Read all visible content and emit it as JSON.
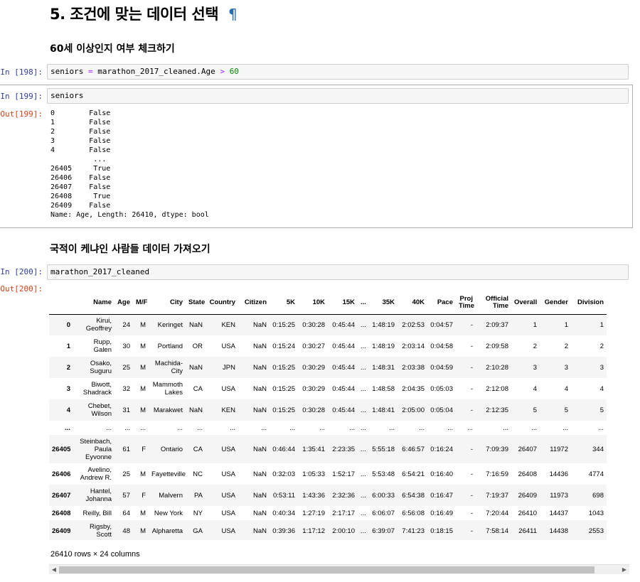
{
  "heading": {
    "title": "5. 조건에 맞는 데이터 선택",
    "anchor": "¶"
  },
  "sub1": "60세 이상인지 여부 체크하기",
  "cell198": {
    "prompt": "In [198]:",
    "code_var": "seniors",
    "code_eq": "=",
    "code_expr": "marathon_2017_cleaned.Age",
    "code_op": ">",
    "code_num": "60"
  },
  "cell199": {
    "prompt": "In [199]:",
    "code": "seniors",
    "out_prompt": "Out[199]:",
    "output": "0        False\n1        False\n2        False\n3        False\n4        False\n          ...\n26405     True\n26406    False\n26407    False\n26408     True\n26409    False\nName: Age, Length: 26410, dtype: bool"
  },
  "sub2": "국적이 케냐인 사람들 데이터 가져오기",
  "cell200": {
    "prompt": "In [200]:",
    "code": "marathon_2017_cleaned",
    "out_prompt": "Out[200]:"
  },
  "table": {
    "columns": [
      "",
      "Name",
      "Age",
      "M/F",
      "City",
      "State",
      "Country",
      "Citizen",
      "5K",
      "10K",
      "15K",
      "...",
      "35K",
      "40K",
      "Pace",
      "Proj Time",
      "Official Time",
      "Overall",
      "Gender",
      "Division"
    ],
    "rows": [
      [
        "0",
        "Kirui, Geoffrey",
        "24",
        "M",
        "Keringet",
        "NaN",
        "KEN",
        "NaN",
        "0:15:25",
        "0:30:28",
        "0:45:44",
        "...",
        "1:48:19",
        "2:02:53",
        "0:04:57",
        "-",
        "2:09:37",
        "1",
        "1",
        "1"
      ],
      [
        "1",
        "Rupp, Galen",
        "30",
        "M",
        "Portland",
        "OR",
        "USA",
        "NaN",
        "0:15:24",
        "0:30:27",
        "0:45:44",
        "...",
        "1:48:19",
        "2:03:14",
        "0:04:58",
        "-",
        "2:09:58",
        "2",
        "2",
        "2"
      ],
      [
        "2",
        "Osako, Suguru",
        "25",
        "M",
        "Machida-City",
        "NaN",
        "JPN",
        "NaN",
        "0:15:25",
        "0:30:29",
        "0:45:44",
        "...",
        "1:48:31",
        "2:03:38",
        "0:04:59",
        "-",
        "2:10:28",
        "3",
        "3",
        "3"
      ],
      [
        "3",
        "Biwott, Shadrack",
        "32",
        "M",
        "Mammoth Lakes",
        "CA",
        "USA",
        "NaN",
        "0:15:25",
        "0:30:29",
        "0:45:44",
        "...",
        "1:48:58",
        "2:04:35",
        "0:05:03",
        "-",
        "2:12:08",
        "4",
        "4",
        "4"
      ],
      [
        "4",
        "Chebet, Wilson",
        "31",
        "M",
        "Marakwet",
        "NaN",
        "KEN",
        "NaN",
        "0:15:25",
        "0:30:28",
        "0:45:44",
        "...",
        "1:48:41",
        "2:05:00",
        "0:05:04",
        "-",
        "2:12:35",
        "5",
        "5",
        "5"
      ],
      [
        "...",
        "...",
        "...",
        "...",
        "...",
        "...",
        "...",
        "...",
        "...",
        "...",
        "...",
        "...",
        "...",
        "...",
        "...",
        "...",
        "...",
        "...",
        "...",
        "..."
      ],
      [
        "26405",
        "Steinbach, Paula Eyvonne",
        "61",
        "F",
        "Ontario",
        "CA",
        "USA",
        "NaN",
        "0:46:44",
        "1:35:41",
        "2:23:35",
        "...",
        "5:55:18",
        "6:46:57",
        "0:16:24",
        "-",
        "7:09:39",
        "26407",
        "11972",
        "344"
      ],
      [
        "26406",
        "Avelino, Andrew R.",
        "25",
        "M",
        "Fayetteville",
        "NC",
        "USA",
        "NaN",
        "0:32:03",
        "1:05:33",
        "1:52:17",
        "...",
        "5:53:48",
        "6:54:21",
        "0:16:40",
        "-",
        "7:16:59",
        "26408",
        "14436",
        "4774"
      ],
      [
        "26407",
        "Hantel, Johanna",
        "57",
        "F",
        "Malvern",
        "PA",
        "USA",
        "NaN",
        "0:53:11",
        "1:43:36",
        "2:32:36",
        "...",
        "6:00:33",
        "6:54:38",
        "0:16:47",
        "-",
        "7:19:37",
        "26409",
        "11973",
        "698"
      ],
      [
        "26408",
        "Reilly, Bill",
        "64",
        "M",
        "New York",
        "NY",
        "USA",
        "NaN",
        "0:40:34",
        "1:27:19",
        "2:17:17",
        "...",
        "6:06:07",
        "6:56:08",
        "0:16:49",
        "-",
        "7:20:44",
        "26410",
        "14437",
        "1043"
      ],
      [
        "26409",
        "Rigsby, Scott",
        "48",
        "M",
        "Alpharetta",
        "GA",
        "USA",
        "NaN",
        "0:39:36",
        "1:17:12",
        "2:00:10",
        "...",
        "6:39:07",
        "7:41:23",
        "0:18:15",
        "-",
        "7:58:14",
        "26411",
        "14438",
        "2553"
      ]
    ]
  },
  "table_note": "26410 rows × 24 columns"
}
